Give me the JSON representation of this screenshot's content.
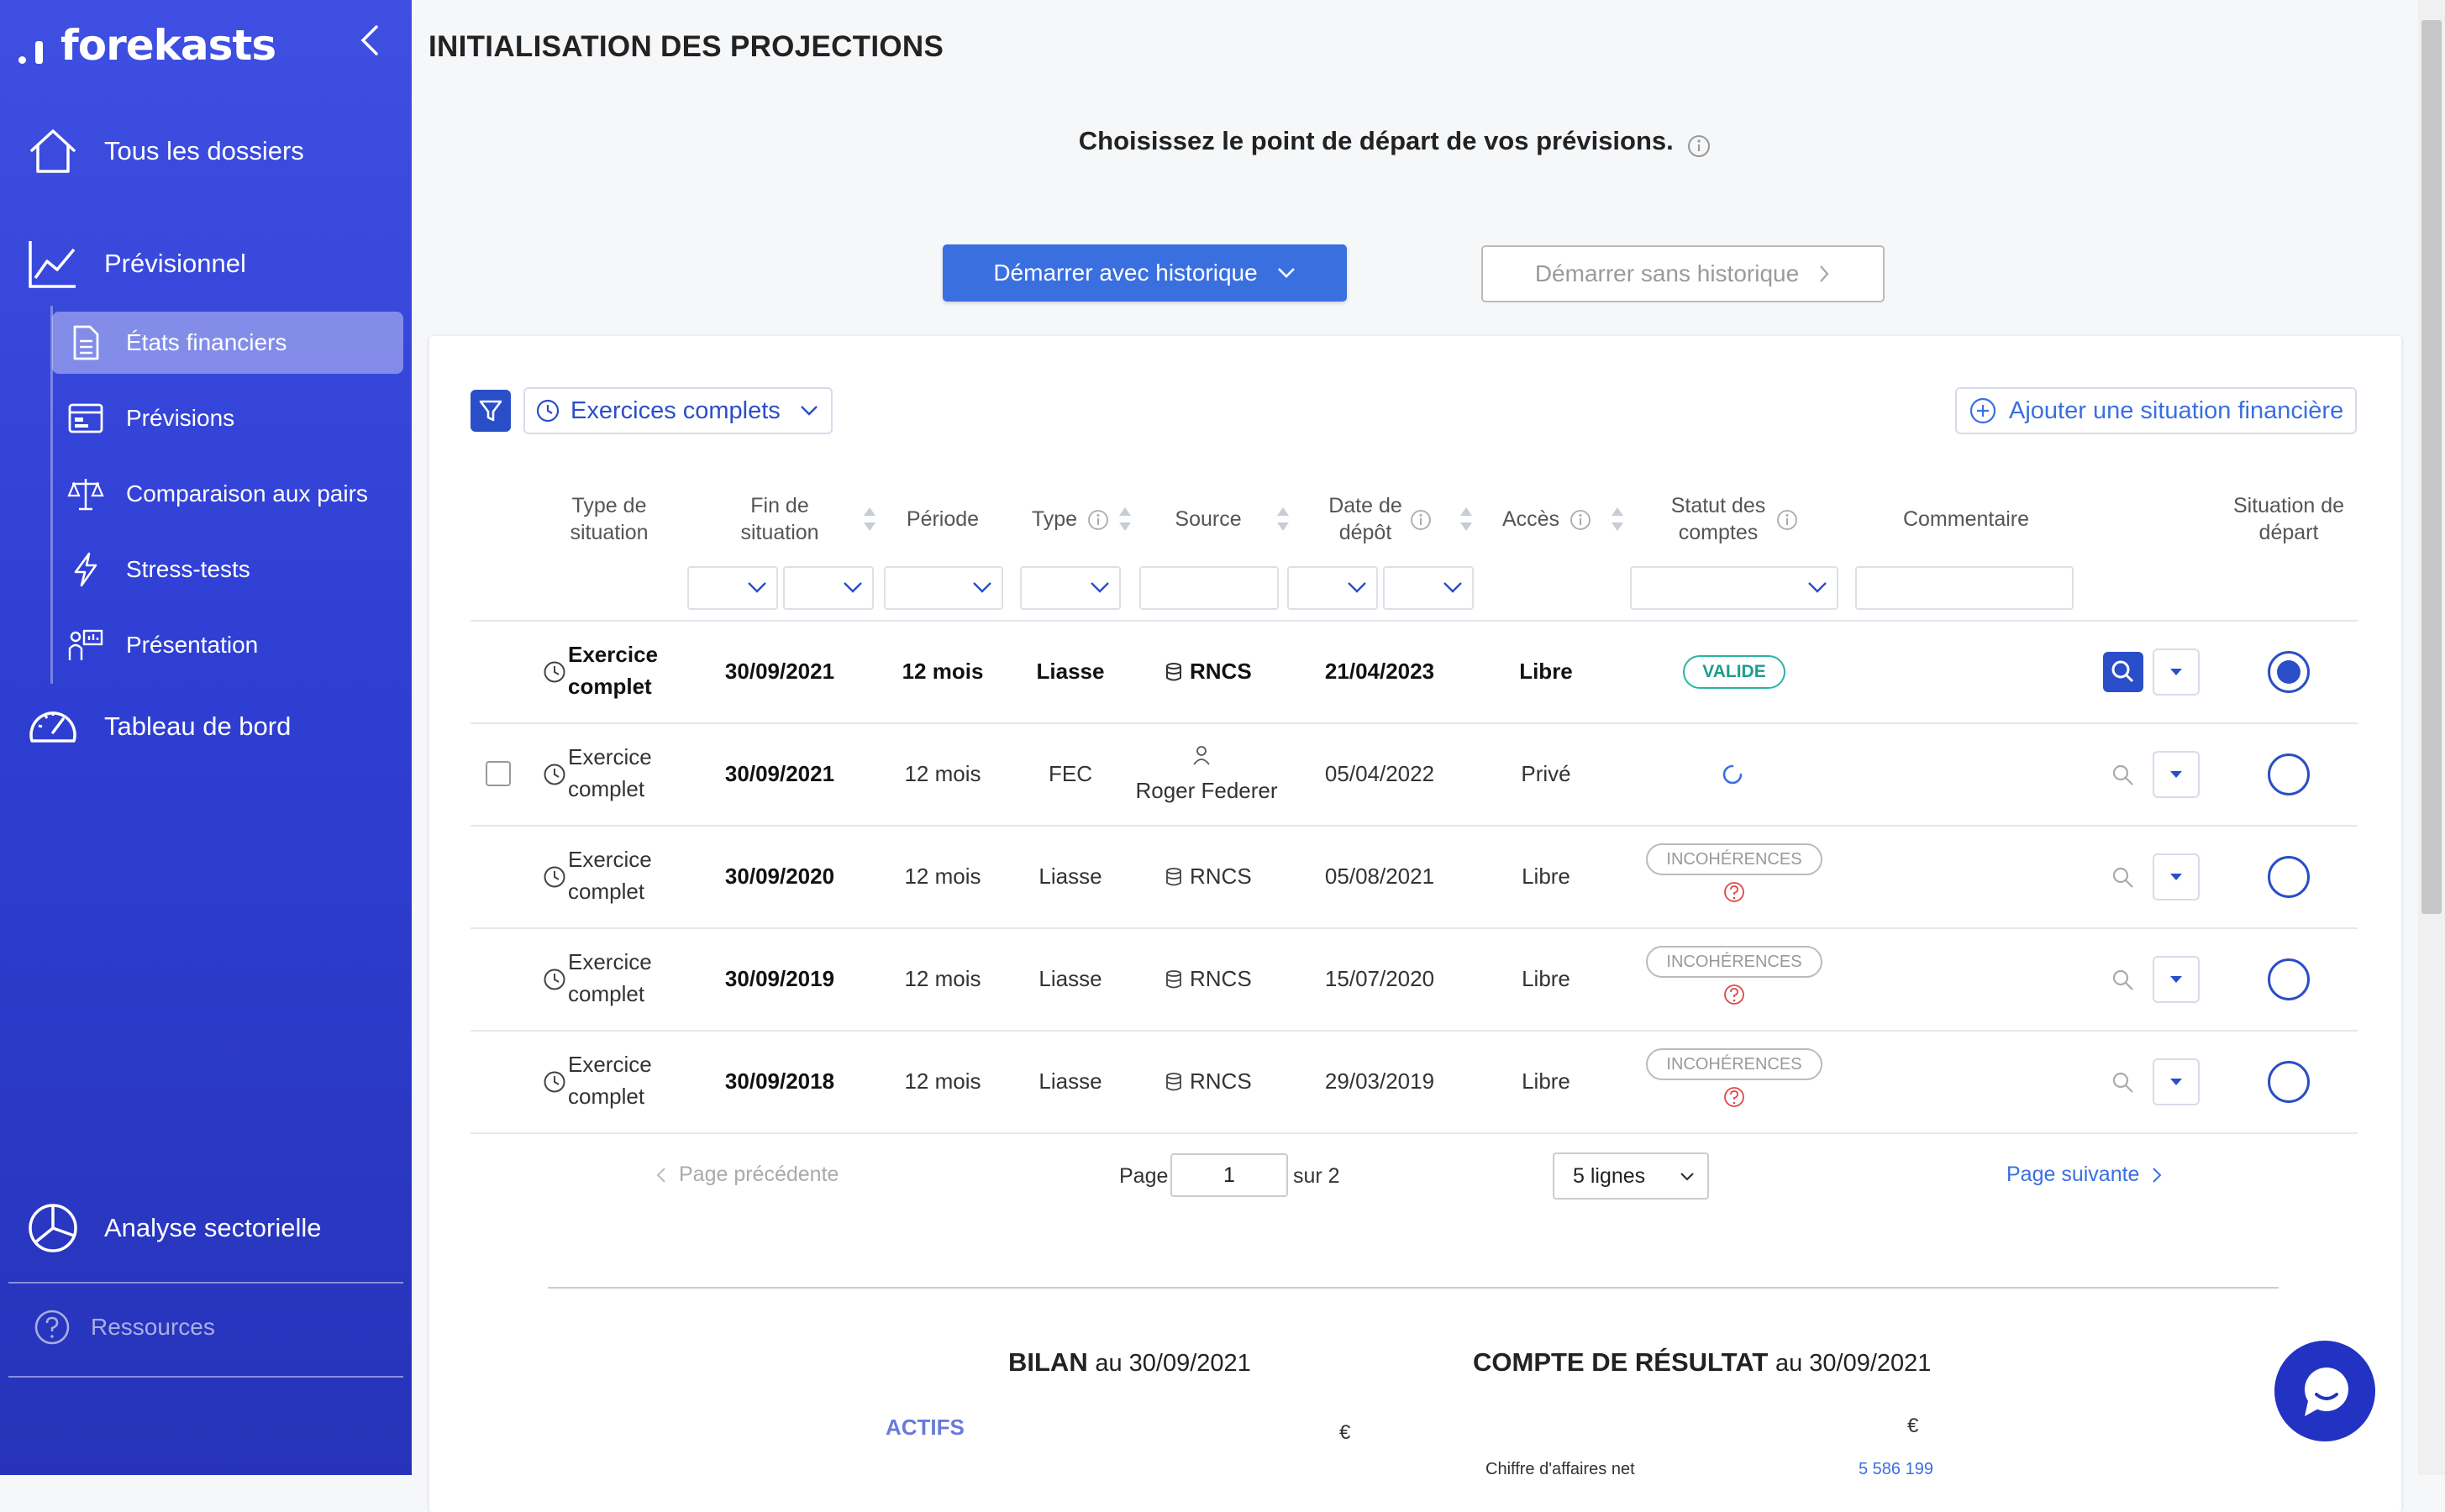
{
  "brand": {
    "name": "forekasts"
  },
  "sidebar": {
    "main_items": [
      {
        "label": "Tous les dossiers",
        "icon": "home-icon"
      },
      {
        "label": "Prévisionnel",
        "icon": "line-chart-icon"
      },
      {
        "label": "Tableau de bord",
        "icon": "gauge-icon"
      },
      {
        "label": "Analyse sectorielle",
        "icon": "pie-chart-icon"
      }
    ],
    "sub_items": [
      {
        "label": "États financiers",
        "icon": "document-icon",
        "active": true
      },
      {
        "label": "Prévisions",
        "icon": "calendar-card-icon"
      },
      {
        "label": "Comparaison aux pairs",
        "icon": "scale-icon"
      },
      {
        "label": "Stress-tests",
        "icon": "lightning-icon"
      },
      {
        "label": "Présentation",
        "icon": "presentation-icon"
      }
    ],
    "resources_label": "Ressources"
  },
  "page": {
    "title": "INITIALISATION DES PROJECTIONS",
    "subtitle": "Choisissez le point de départ de vos prévisions.",
    "start_with_history": "Démarrer avec historique",
    "start_without_history": "Démarrer sans historique"
  },
  "toolbar": {
    "period_filter": "Exercices complets",
    "add_situation": "Ajouter une situation financière"
  },
  "table": {
    "headers": {
      "type_situation": "Type de situation",
      "fin_situation": "Fin de situation",
      "periode": "Période",
      "type": "Type",
      "source": "Source",
      "date_depot": "Date de dépôt",
      "acces": "Accès",
      "statut": "Statut des comptes",
      "commentaire": "Commentaire",
      "situation_depart": "Situation de départ"
    },
    "rows": [
      {
        "type_situation": "Exercice complet",
        "fin": "30/09/2021",
        "periode": "12 mois",
        "type": "Liasse",
        "source": "RNCS",
        "date_depot": "21/04/2023",
        "acces": "Libre",
        "statut": "VALIDE",
        "selected": true
      },
      {
        "type_situation": "Exercice complet",
        "fin": "30/09/2021",
        "periode": "12 mois",
        "type": "FEC",
        "source": "Roger Federer",
        "date_depot": "05/04/2022",
        "acces": "Privé",
        "statut": ""
      },
      {
        "type_situation": "Exercice complet",
        "fin": "30/09/2020",
        "periode": "12 mois",
        "type": "Liasse",
        "source": "RNCS",
        "date_depot": "05/08/2021",
        "acces": "Libre",
        "statut": "INCOHÉRENCES"
      },
      {
        "type_situation": "Exercice complet",
        "fin": "30/09/2019",
        "periode": "12 mois",
        "type": "Liasse",
        "source": "RNCS",
        "date_depot": "15/07/2020",
        "acces": "Libre",
        "statut": "INCOHÉRENCES"
      },
      {
        "type_situation": "Exercice complet",
        "fin": "30/09/2018",
        "periode": "12 mois",
        "type": "Liasse",
        "source": "RNCS",
        "date_depot": "29/03/2019",
        "acces": "Libre",
        "statut": "INCOHÉRENCES"
      }
    ]
  },
  "pagination": {
    "prev": "Page précédente",
    "page_label": "Page",
    "current": "1",
    "of_label": "sur 2",
    "lines": "5 lignes",
    "next": "Page suivante"
  },
  "bilan": {
    "title": "BILAN",
    "date": "au 30/09/2021",
    "actifs": "ACTIFS",
    "currency": "€"
  },
  "compte": {
    "title": "COMPTE DE RÉSULTAT",
    "date": "au 30/09/2021",
    "currency": "€",
    "ca_label": "Chiffre d'affaires net",
    "ca_value": "5 586 199"
  },
  "colors": {
    "sidebar": "#2f3fd3",
    "primary": "#3a6fe0",
    "accent": "#2a4ec7",
    "valid": "#2bb3a3",
    "error": "#e04545"
  }
}
